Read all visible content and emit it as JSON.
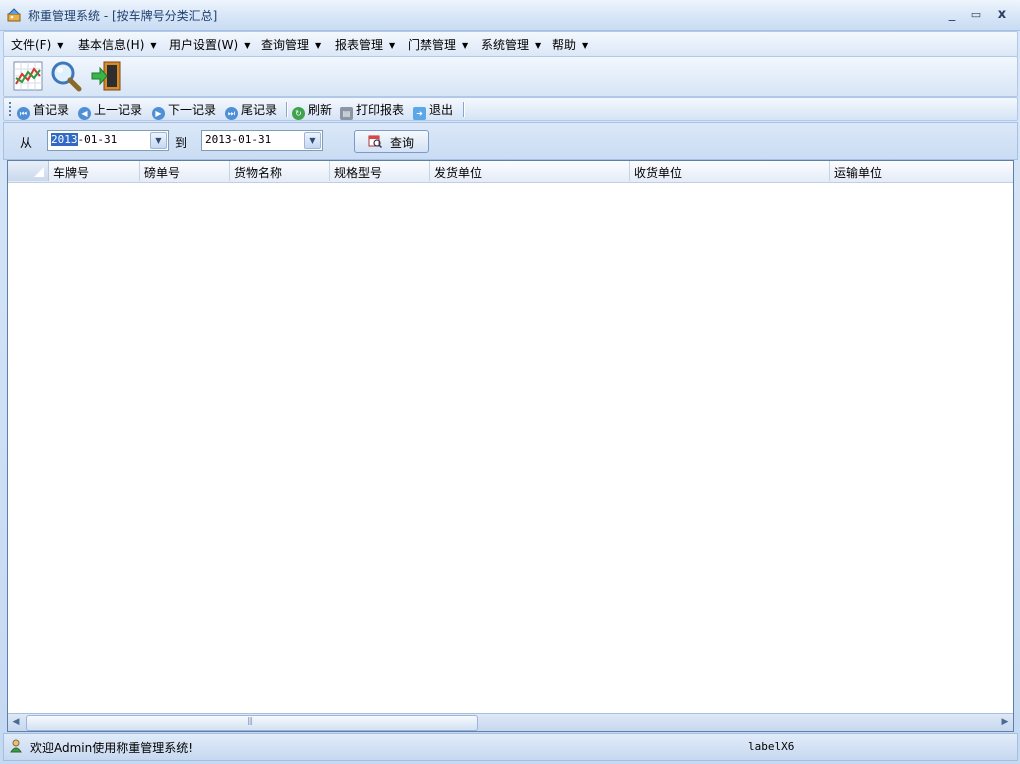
{
  "window": {
    "title": "称重管理系统 - [按车牌号分类汇总]",
    "minimize": "_",
    "restore": "▭",
    "close": "x"
  },
  "menu": [
    {
      "label": "文件(F)"
    },
    {
      "label": "基本信息(H)"
    },
    {
      "label": "用户设置(W)"
    },
    {
      "label": "查询管理"
    },
    {
      "label": "报表管理"
    },
    {
      "label": "门禁管理"
    },
    {
      "label": "系统管理"
    },
    {
      "label": "帮助"
    }
  ],
  "big_toolbar": [
    {
      "icon": "chart-icon"
    },
    {
      "icon": "magnifier-icon"
    },
    {
      "icon": "exit-door-icon"
    }
  ],
  "record_toolbar": {
    "first": "首记录",
    "prev": "上一记录",
    "next": "下一记录",
    "last": "尾记录",
    "refresh": "刷新",
    "print": "打印报表",
    "exit": "退出"
  },
  "filter": {
    "from_label": "从",
    "from_value_selected": "2013",
    "from_value_rest": "-01-31",
    "to_label": "到",
    "to_value": "2013-01-31",
    "query_label": "查询"
  },
  "grid": {
    "columns": [
      "车牌号",
      "磅单号",
      "货物名称",
      "规格型号",
      "发货单位",
      "收货单位",
      "运输单位"
    ],
    "rows": []
  },
  "status": {
    "message": "欢迎Admin使用称重管理系统!",
    "label": "labelX6"
  },
  "colors": {
    "accent": "#316ac5",
    "title_text": "#1e3f6e",
    "frame": "#c4d9f2"
  }
}
